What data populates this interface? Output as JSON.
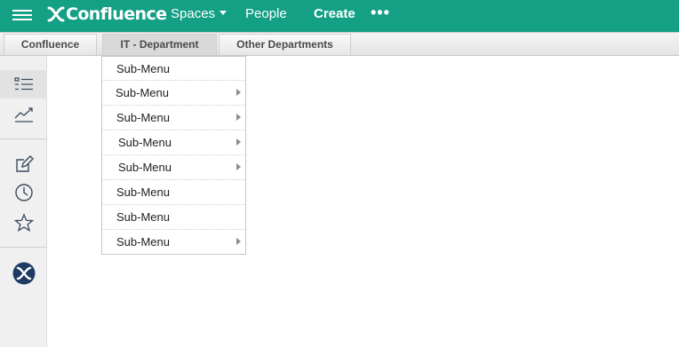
{
  "header": {
    "logo_text": "Confluence",
    "nav": {
      "spaces": "Spaces",
      "people": "People",
      "create": "Create",
      "more": "•••"
    },
    "bg_color": "#14a085"
  },
  "tabs": [
    {
      "label": "Confluence"
    },
    {
      "label": "IT - Department"
    },
    {
      "label": "Other Departments"
    }
  ],
  "sidebar": {
    "icons": [
      "list-icon",
      "trend-chart-icon",
      "edit-icon",
      "clock-icon",
      "star-icon",
      "confluence-logo-icon"
    ]
  },
  "dropdown": {
    "items": [
      {
        "label": "Sub-Menu",
        "has_submenu": false
      },
      {
        "label": "Sub-Menu",
        "has_submenu": true
      },
      {
        "label": "Sub-Menu",
        "has_submenu": true
      },
      {
        "label": "Sub-Menu",
        "has_submenu": true
      },
      {
        "label": "Sub-Menu",
        "has_submenu": true
      },
      {
        "label": "Sub-Menu",
        "has_submenu": false
      },
      {
        "label": "Sub-Menu",
        "has_submenu": false
      },
      {
        "label": "Sub-Menu",
        "has_submenu": true
      }
    ]
  }
}
